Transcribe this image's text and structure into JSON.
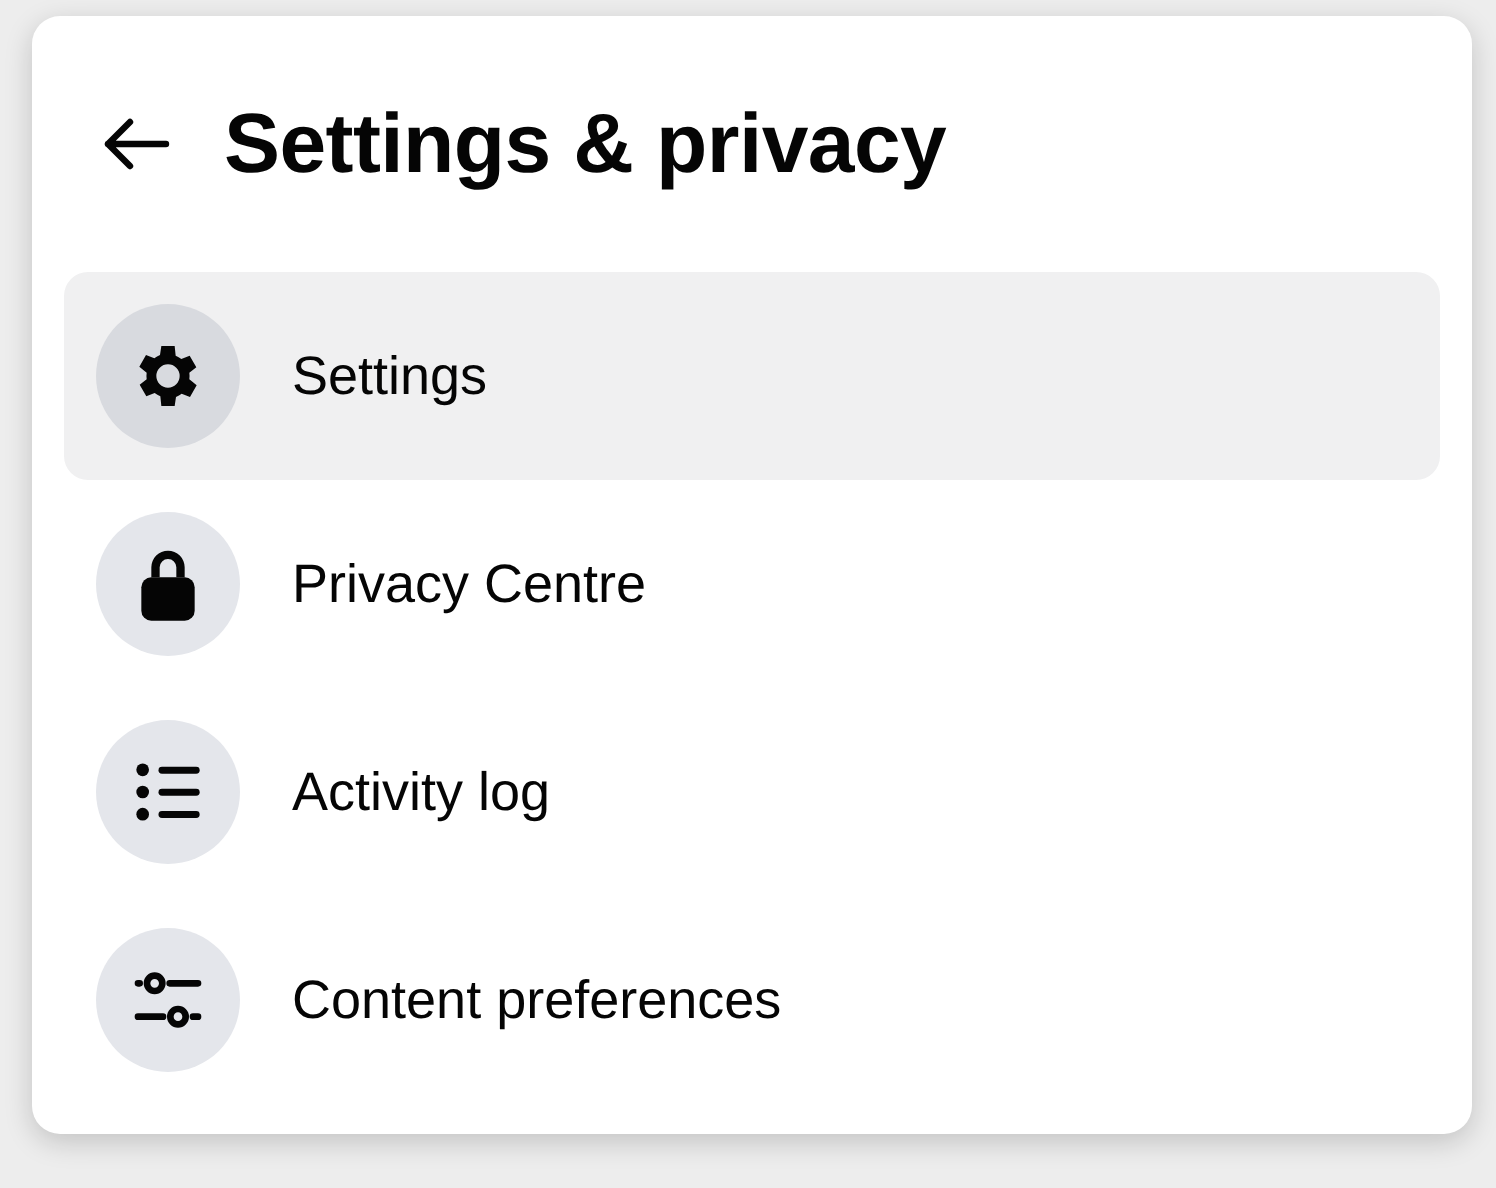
{
  "title": "Settings & privacy",
  "items": [
    {
      "label": "Settings",
      "kind": "gear",
      "selected": true
    },
    {
      "label": "Privacy Centre",
      "kind": "lock",
      "selected": false
    },
    {
      "label": "Activity log",
      "kind": "list",
      "selected": false
    },
    {
      "label": "Content preferences",
      "kind": "sliders",
      "selected": false
    }
  ]
}
